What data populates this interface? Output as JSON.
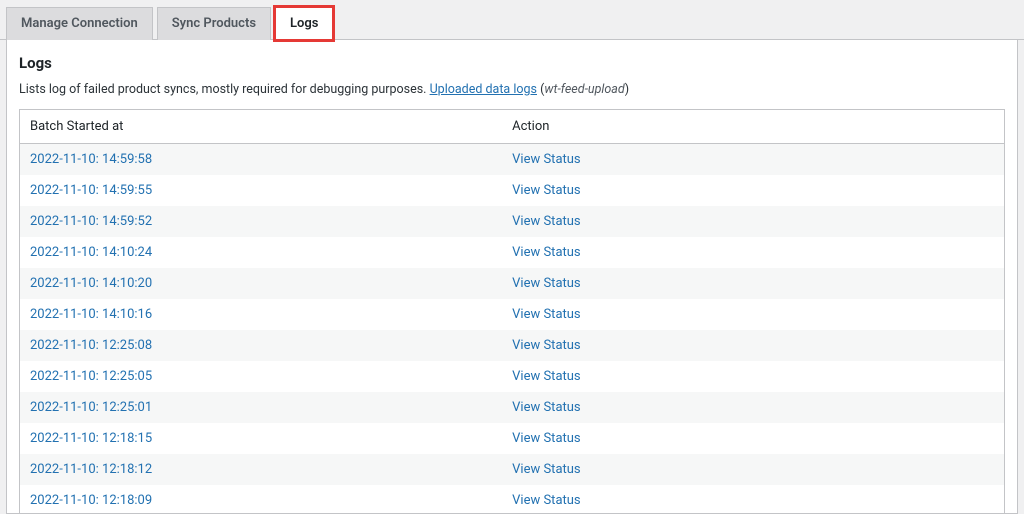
{
  "tabs": [
    {
      "label": "Manage Connection",
      "active": false
    },
    {
      "label": "Sync Products",
      "active": false
    },
    {
      "label": "Logs",
      "active": true,
      "highlighted": true
    }
  ],
  "page": {
    "title": "Logs",
    "description_prefix": "Lists log of failed product syncs, mostly required for debugging purposes. ",
    "description_link": "Uploaded data logs",
    "description_suffix_open": " (",
    "description_slug": "wt-feed-upload",
    "description_suffix_close": ")"
  },
  "table": {
    "columns": {
      "col1": "Batch Started at",
      "col2": "Action"
    },
    "action_label": "View Status",
    "rows": [
      {
        "started_at": "2022-11-10: 14:59:58"
      },
      {
        "started_at": "2022-11-10: 14:59:55"
      },
      {
        "started_at": "2022-11-10: 14:59:52"
      },
      {
        "started_at": "2022-11-10: 14:10:24"
      },
      {
        "started_at": "2022-11-10: 14:10:20"
      },
      {
        "started_at": "2022-11-10: 14:10:16"
      },
      {
        "started_at": "2022-11-10: 12:25:08"
      },
      {
        "started_at": "2022-11-10: 12:25:05"
      },
      {
        "started_at": "2022-11-10: 12:25:01"
      },
      {
        "started_at": "2022-11-10: 12:18:15"
      },
      {
        "started_at": "2022-11-10: 12:18:12"
      },
      {
        "started_at": "2022-11-10: 12:18:09"
      }
    ]
  }
}
